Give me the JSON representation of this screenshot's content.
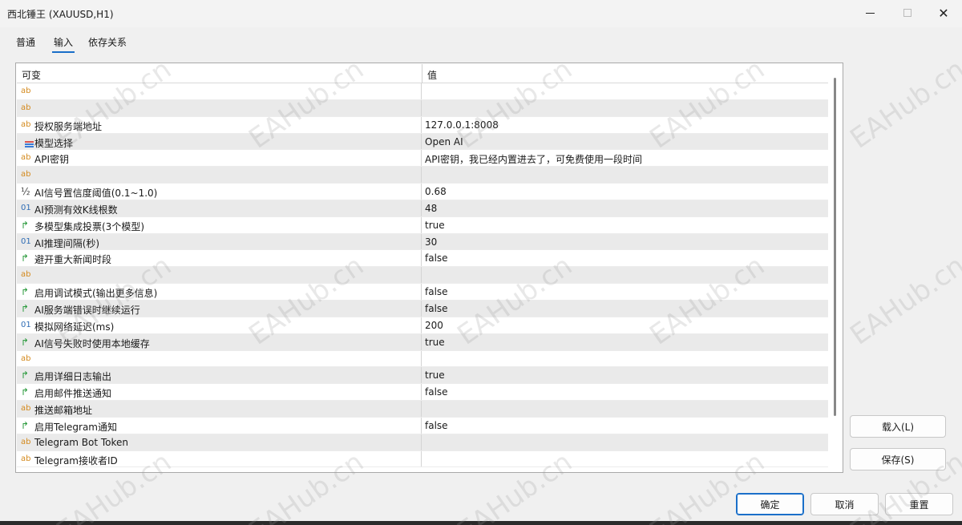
{
  "window": {
    "title": "西北锤王 (XAUUSD,H1)"
  },
  "tabs": [
    {
      "label": "普通"
    },
    {
      "label": "输入"
    },
    {
      "label": "依存关系"
    }
  ],
  "grid": {
    "headers": {
      "name": "可变",
      "value": "值"
    },
    "rows": [
      {
        "type": "ab",
        "icon": "string-icon",
        "label": "",
        "value": ""
      },
      {
        "type": "ab",
        "icon": "string-icon",
        "label": "",
        "value": ""
      },
      {
        "type": "ab",
        "icon": "string-icon",
        "label": "授权服务端地址",
        "value": "127.0.0.1:8008"
      },
      {
        "type": "enum",
        "icon": "enum-icon",
        "label": "模型选择",
        "value": "Open AI"
      },
      {
        "type": "ab",
        "icon": "string-icon",
        "label": "API密钥",
        "value": "API密钥，我已经内置进去了，可免费使用一段时间"
      },
      {
        "type": "ab",
        "icon": "string-icon",
        "label": "",
        "value": ""
      },
      {
        "type": "frac",
        "icon": "double-icon",
        "label": "AI信号置信度阈值(0.1~1.0)",
        "value": "0.68"
      },
      {
        "type": "num",
        "icon": "integer-icon",
        "label": "AI预测有效K线根数",
        "value": "48"
      },
      {
        "type": "bool",
        "icon": "bool-icon",
        "label": "多模型集成投票(3个模型)",
        "value": "true"
      },
      {
        "type": "num",
        "icon": "integer-icon",
        "label": "AI推理间隔(秒)",
        "value": "30"
      },
      {
        "type": "bool",
        "icon": "bool-icon",
        "label": "避开重大新闻时段",
        "value": "false"
      },
      {
        "type": "ab",
        "icon": "string-icon",
        "label": "",
        "value": ""
      },
      {
        "type": "bool",
        "icon": "bool-icon",
        "label": "启用调试模式(输出更多信息)",
        "value": "false"
      },
      {
        "type": "bool",
        "icon": "bool-icon",
        "label": "AI服务端错误时继续运行",
        "value": "false"
      },
      {
        "type": "num",
        "icon": "integer-icon",
        "label": "模拟网络延迟(ms)",
        "value": "200"
      },
      {
        "type": "bool",
        "icon": "bool-icon",
        "label": "AI信号失败时使用本地缓存",
        "value": "true"
      },
      {
        "type": "ab",
        "icon": "string-icon",
        "label": "",
        "value": ""
      },
      {
        "type": "bool",
        "icon": "bool-icon",
        "label": "启用详细日志输出",
        "value": "true"
      },
      {
        "type": "bool",
        "icon": "bool-icon",
        "label": "启用邮件推送通知",
        "value": "false"
      },
      {
        "type": "ab",
        "icon": "string-icon",
        "label": "推送邮箱地址",
        "value": ""
      },
      {
        "type": "bool",
        "icon": "bool-icon",
        "label": "启用Telegram通知",
        "value": "false"
      },
      {
        "type": "ab",
        "icon": "string-icon",
        "label": "Telegram Bot Token",
        "value": ""
      },
      {
        "type": "ab",
        "icon": "string-icon",
        "label": "Telegram接收者ID",
        "value": ""
      }
    ]
  },
  "side_buttons": {
    "load": "载入(L)",
    "save": "保存(S)"
  },
  "footer_buttons": {
    "ok": "确定",
    "cancel": "取消",
    "reset": "重置"
  },
  "watermark": "EAHub.cn",
  "colors": {
    "accent": "#1a6fc9",
    "string_icon": "#d48a1e",
    "bool_icon": "#2a9a3c",
    "integer_icon": "#2f6db5"
  }
}
